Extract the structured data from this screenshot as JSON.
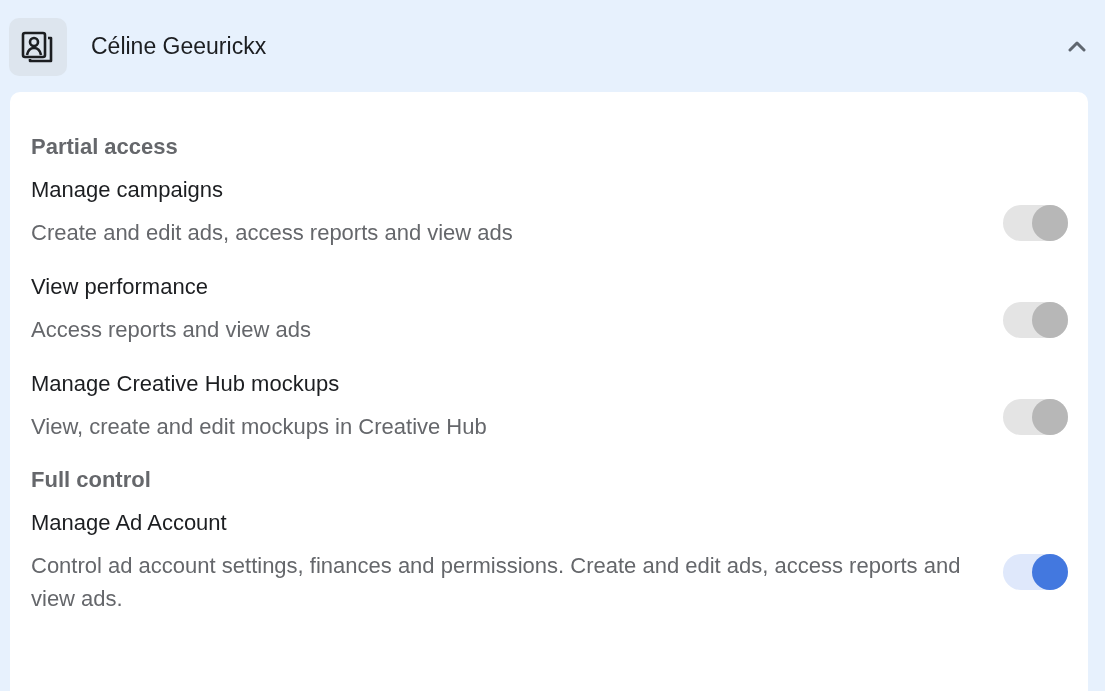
{
  "header": {
    "name": "Céline Geeurickx",
    "expanded": true
  },
  "sections": [
    {
      "heading": "Partial access",
      "items": [
        {
          "title": "Manage campaigns",
          "description": "Create and edit ads, access reports and view ads",
          "on": true,
          "disabled": true
        },
        {
          "title": "View performance",
          "description": "Access reports and view ads",
          "on": true,
          "disabled": true
        },
        {
          "title": "Manage Creative Hub mockups",
          "description": "View, create and edit mockups in Creative Hub",
          "on": true,
          "disabled": true
        }
      ]
    },
    {
      "heading": "Full control",
      "items": [
        {
          "title": "Manage Ad Account",
          "description": "Control ad account settings, finances and permissions. Create and edit ads, access reports and view ads.",
          "on": true,
          "disabled": false
        }
      ]
    }
  ]
}
